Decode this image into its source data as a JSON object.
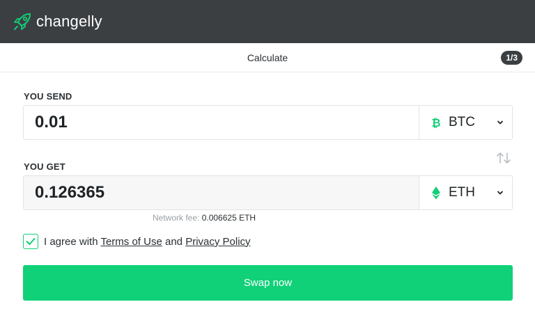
{
  "header": {
    "logo_text": "changelly",
    "logo_icon": "rocket-icon"
  },
  "step": {
    "title": "Calculate",
    "badge": "1/3"
  },
  "send": {
    "label": "YOU SEND",
    "amount": "0.01",
    "currency": "BTC",
    "currency_icon": "bitcoin-icon",
    "currency_color": "#10d078"
  },
  "get": {
    "label": "YOU GET",
    "amount": "0.126365",
    "currency": "ETH",
    "currency_icon": "ethereum-icon",
    "currency_color": "#10d078"
  },
  "fee": {
    "label": "Network fee:",
    "value": "0.006625 ETH"
  },
  "agreement": {
    "checked": true,
    "prefix": "I agree with",
    "terms_link": "Terms of Use",
    "conjunction": "and",
    "privacy_link": "Privacy Policy"
  },
  "action": {
    "swap_label": "Swap now"
  },
  "colors": {
    "brand_green": "#10d078",
    "topbar": "#3b3f42"
  }
}
